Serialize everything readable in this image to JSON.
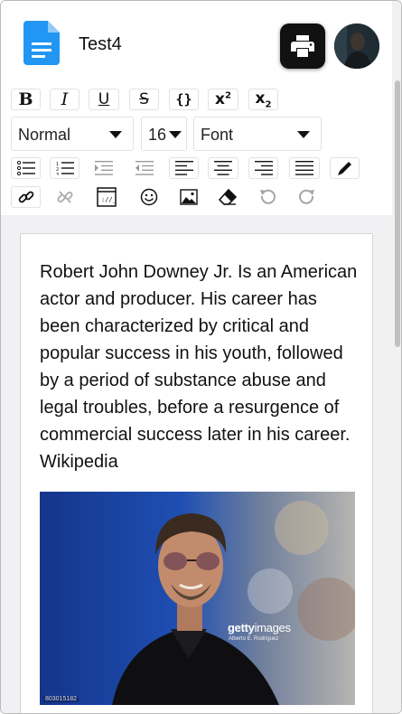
{
  "document": {
    "title": "Test4"
  },
  "header": {
    "print_icon": "printer-icon",
    "doc_icon": "document-icon",
    "avatar_icon": "user-avatar"
  },
  "toolbar": {
    "format_buttons": [
      "bold",
      "italic",
      "underline",
      "strikethrough",
      "code",
      "superscript",
      "subscript"
    ],
    "block_type": "Normal",
    "font_size": "16",
    "font_family": "Font",
    "paragraph_buttons": [
      "bulleted-list",
      "numbered-list",
      "indent",
      "outdent",
      "align-left",
      "align-center",
      "align-right",
      "align-justify",
      "color-picker"
    ],
    "insert_buttons": [
      "link",
      "unlink",
      "embed",
      "emoji",
      "image",
      "remove-formatting",
      "undo",
      "redo"
    ]
  },
  "content": {
    "paragraph": "Robert John Downey Jr. Is an American actor and producer. His career has been characterized by critical and popular success in his youth, followed by a period of substance abuse and legal troubles, before a resurgence of commercial success later in his career. Wikipedia",
    "image": {
      "watermark_brand": "getty",
      "watermark_suffix": "images",
      "watermark_credit": "Alberto E. Rodriguez",
      "image_id": "803015182"
    }
  },
  "colors": {
    "doc_icon": "#2196f3",
    "print_button": "#111111",
    "editor_background": "#f1f1f3"
  }
}
